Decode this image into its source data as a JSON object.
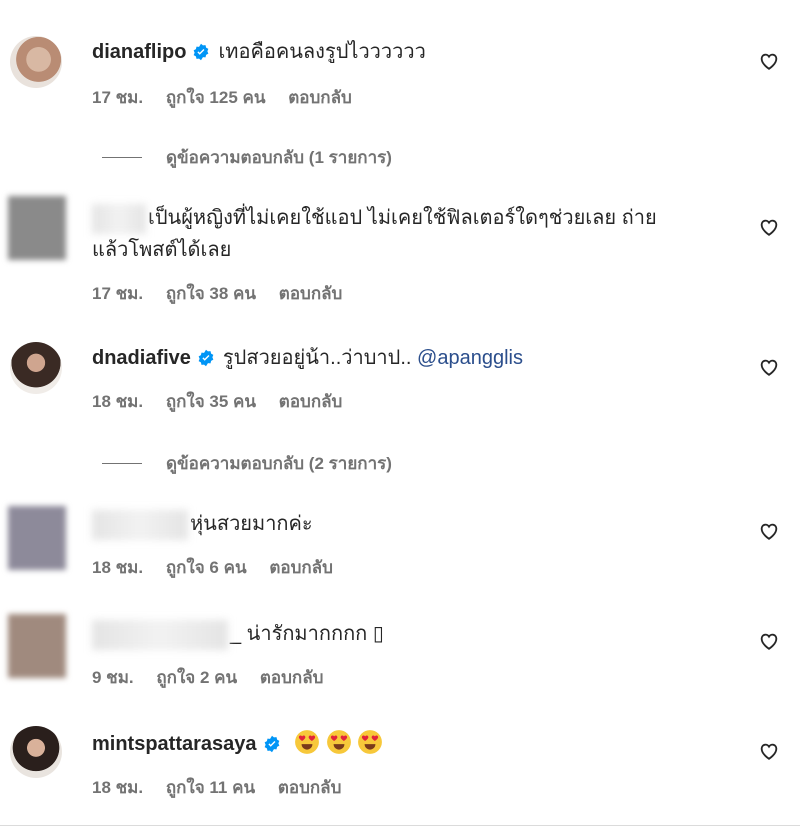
{
  "comments": [
    {
      "username": "dianaflipo",
      "verified": true,
      "text": "เทอคือคนลงรูปไวววววว",
      "time": "17 ชม.",
      "likes": "ถูกใจ 125 คน",
      "reply": "ตอบกลับ",
      "view_replies": "ดูข้อความตอบกลับ (1 รายการ)"
    },
    {
      "username": "",
      "verified": false,
      "text": "เป็นผู้หญิงที่ไม่เคยใช้แอป ไม่เคยใช้ฟิลเตอร์ใดๆช่วยเลย ถ่าย",
      "text2": "แล้วโพสต์ได้เลย",
      "time": "17 ชม.",
      "likes": "ถูกใจ 38 คน",
      "reply": "ตอบกลับ"
    },
    {
      "username": "dnadiafive",
      "verified": true,
      "text": "รูปสวยอยู่น้า..ว่าบาป..",
      "mention": "@apangglis",
      "time": "18 ชม.",
      "likes": "ถูกใจ 35 คน",
      "reply": "ตอบกลับ",
      "view_replies": "ดูข้อความตอบกลับ (2 รายการ)"
    },
    {
      "username": "",
      "verified": false,
      "text": "หุ่นสวยมากค่ะ",
      "time": "18 ชม.",
      "likes": "ถูกใจ 6 คน",
      "reply": "ตอบกลับ"
    },
    {
      "username": "",
      "verified": false,
      "text": "_ น่ารักมากกกก",
      "glyph": "▯",
      "time": "9 ชม.",
      "likes": "ถูกใจ 2 คน",
      "reply": "ตอบกลับ"
    },
    {
      "username": "mintspattarasaya",
      "verified": true,
      "text": "",
      "emoji": "heart-eyes x3",
      "time": "18 ชม.",
      "likes": "ถูกใจ 11 คน",
      "reply": "ตอบกลับ"
    }
  ],
  "colors": {
    "verified": "#0095f6",
    "meta": "#737373",
    "mention": "#2b4e8c",
    "emoji": "#f7c83a"
  }
}
